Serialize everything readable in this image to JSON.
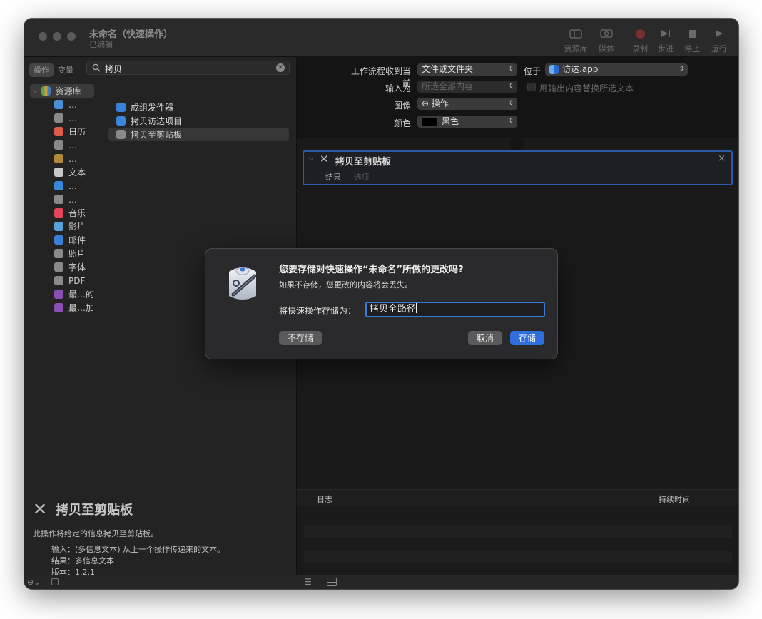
{
  "window": {
    "title": "未命名（快速操作）",
    "subtitle": "已编辑"
  },
  "toolbar": {
    "library_label": "资源库",
    "media_label": "媒体",
    "record_label": "录制",
    "step_label": "步进",
    "stop_label": "停止",
    "run_label": "运行"
  },
  "sidebar": {
    "segment_actions": "操作",
    "segment_variables": "变量",
    "search_value": "拷贝",
    "library_root": "资源库",
    "library_items": [
      {
        "label": "…",
        "icon": "globe-icon",
        "color": "#4a8fd6"
      },
      {
        "label": "…",
        "icon": "tools-icon",
        "color": "#8a8a8a"
      },
      {
        "label": "日历",
        "icon": "calendar-icon",
        "color": "#e05a4a"
      },
      {
        "label": "…",
        "icon": "tools-icon",
        "color": "#8a8a8a"
      },
      {
        "label": "…",
        "icon": "box-icon",
        "color": "#b08a3a"
      },
      {
        "label": "文本",
        "icon": "text-icon",
        "color": "#c8c8c8"
      },
      {
        "label": "…",
        "icon": "finder-icon",
        "color": "#3a86d8"
      },
      {
        "label": "…",
        "icon": "keyboard-icon",
        "color": "#8a8a8a"
      },
      {
        "label": "音乐",
        "icon": "music-icon",
        "color": "#e8455a"
      },
      {
        "label": "影片",
        "icon": "movie-icon",
        "color": "#5aa0d8"
      },
      {
        "label": "邮件",
        "icon": "mail-icon",
        "color": "#3a7fd8"
      },
      {
        "label": "照片",
        "icon": "photo-icon",
        "color": "#8a8a8a"
      },
      {
        "label": "字体",
        "icon": "font-icon",
        "color": "#8a8a8a"
      },
      {
        "label": "PDF",
        "icon": "pdf-icon",
        "color": "#8a8a8a"
      },
      {
        "label": "最…的",
        "icon": "folder-icon",
        "color": "#8a4fb0"
      },
      {
        "label": "最…加",
        "icon": "folder-icon",
        "color": "#8a4fb0"
      }
    ],
    "actions": [
      {
        "label": "成组发件器",
        "icon": "mail-icon",
        "color": "#3a7fd8"
      },
      {
        "label": "拷贝访达项目",
        "icon": "finder-icon",
        "color": "#3a86d8"
      },
      {
        "label": "拷贝至剪贴板",
        "icon": "tools-icon",
        "color": "#8a8a8a"
      }
    ],
    "description": {
      "title": "拷贝至剪贴板",
      "summary": "此操作将给定的信息拷贝至剪贴板。",
      "input": "输入：(多信息文本) 从上一个操作传递来的文本。",
      "result": "结果：多信息文本",
      "version": "版本：1.2.1"
    }
  },
  "workflow": {
    "receives_label": "工作流程收到当前",
    "receives_value": "文件或文件夹",
    "in_label": "位于",
    "in_value": "访达.app",
    "input_label": "输入为",
    "input_value": "所选全部内容",
    "replace_label": "用输出内容替换所选文本",
    "image_label": "图像",
    "image_value": "⊖ 操作",
    "color_label": "颜色",
    "color_value": "黑色"
  },
  "action_card": {
    "title": "拷贝至剪贴板",
    "tab_results": "结果",
    "tab_options": "选项"
  },
  "log": {
    "col_log": "日志",
    "col_duration": "持续时间"
  },
  "dialog": {
    "question": "您要存储对快速操作“未命名”所做的更改吗?",
    "subtext": "如果不存储，您更改的内容将会丢失。",
    "save_as_label": "将快速操作存储为：",
    "name_value": "拷贝全路径",
    "dont_save": "不存储",
    "cancel": "取消",
    "save": "存储"
  }
}
